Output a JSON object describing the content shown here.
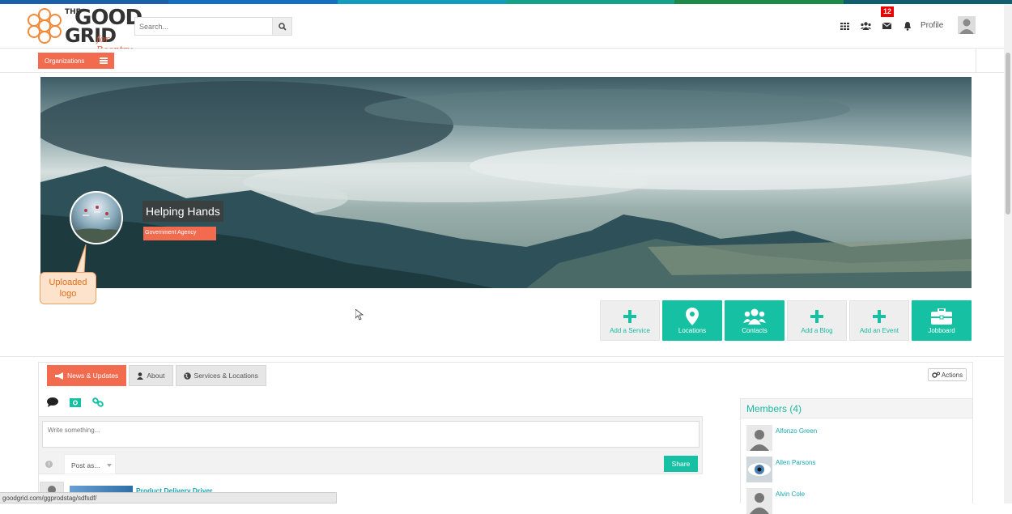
{
  "brand": {
    "the": "THE",
    "good": "GOOD",
    "grid": "GRID",
    "tagline": "for Reentry",
    "stripe_colors": [
      "#1a5fa8",
      "#1570c0",
      "#139dbd",
      "#12a38a",
      "#1d8a4a",
      "#0f5f6e"
    ]
  },
  "search": {
    "placeholder": "Search...",
    "icon": "search-icon"
  },
  "header": {
    "icons": [
      "apps-grid-icon",
      "groups-icon",
      "envelope-icon",
      "bell-icon"
    ],
    "message_badge": "12",
    "profile_label": "Profile"
  },
  "org_menu": {
    "label": "Organizations"
  },
  "org": {
    "name": "Helping Hands",
    "type": "Government Agency",
    "logo_callout": "Uploaded logo"
  },
  "action_buttons": [
    {
      "label": "Add a Service",
      "icon": "plus-icon",
      "style": "light"
    },
    {
      "label": "Locations",
      "icon": "map-marker-icon",
      "style": "dark"
    },
    {
      "label": "Contacts",
      "icon": "users-icon",
      "style": "dark"
    },
    {
      "label": "Add a Blog",
      "icon": "plus-icon",
      "style": "light"
    },
    {
      "label": "Add an Event",
      "icon": "plus-icon",
      "style": "light"
    },
    {
      "label": "Jobboard",
      "icon": "briefcase-icon",
      "style": "dark"
    }
  ],
  "tabs": [
    {
      "label": "News & Updates",
      "icon": "bullhorn-icon",
      "active": true
    },
    {
      "label": "About",
      "icon": "user-icon",
      "active": false
    },
    {
      "label": "Services & Locations",
      "icon": "globe-icon",
      "active": false
    }
  ],
  "actions_menu": {
    "label": "Actions"
  },
  "composer": {
    "placeholder": "Write something...",
    "post_as": "Post as...",
    "share": "Share"
  },
  "feed": [
    {
      "title": "Product Delivery Driver"
    }
  ],
  "members": {
    "heading": "Members (4)",
    "list": [
      {
        "name": "Alfonzo Green"
      },
      {
        "name": "Allen Parsons"
      },
      {
        "name": "Alvin Cole"
      }
    ]
  },
  "colors": {
    "accent": "#16c1a3",
    "orange": "#f26b4f"
  },
  "status_url": "goodgrid.com/ggprodstag/sdfsdf/"
}
